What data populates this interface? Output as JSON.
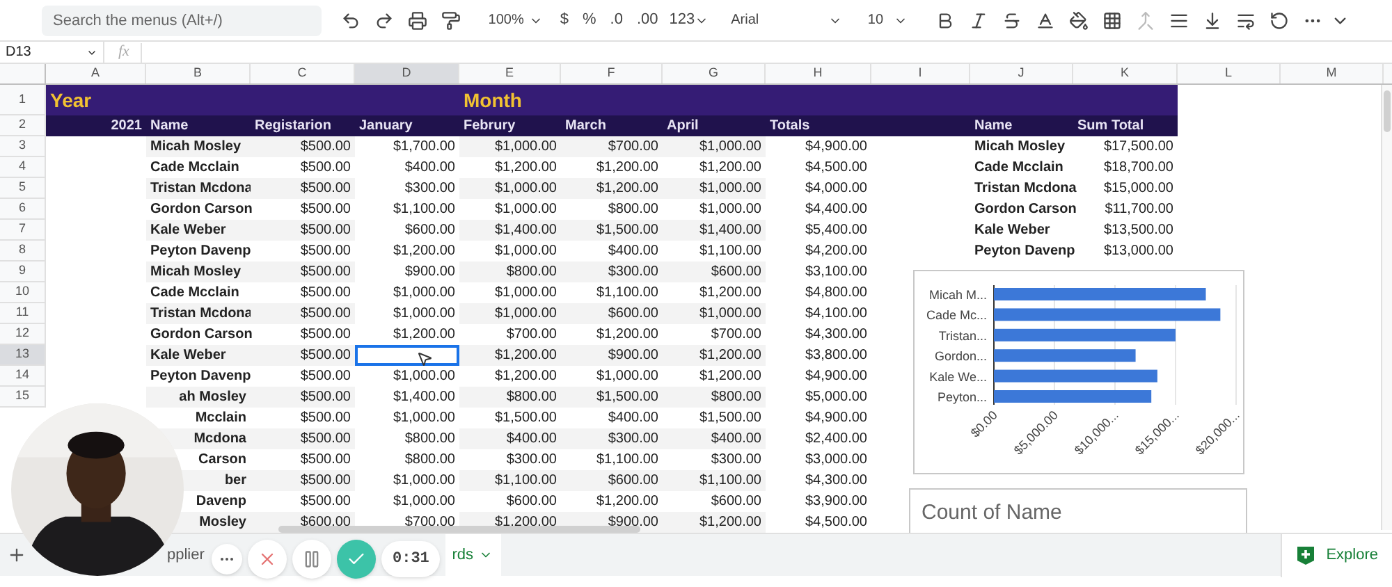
{
  "toolbar": {
    "search": {
      "placeholder": "Search the menus (Alt+/)"
    },
    "zoom": "100%",
    "currency": "$",
    "percent": "%",
    "decrease_decimals": ".0",
    "increase_decimals": ".00",
    "number_format": "123",
    "font": "Arial",
    "font_size": "10"
  },
  "formula_bar": {
    "cell_ref": "D13",
    "fx": "fx"
  },
  "columns": [
    {
      "label": "A",
      "selected": false
    },
    {
      "label": "B",
      "selected": false
    },
    {
      "label": "C",
      "selected": false
    },
    {
      "label": "D",
      "selected": true
    },
    {
      "label": "E",
      "selected": false
    },
    {
      "label": "F",
      "selected": false
    },
    {
      "label": "G",
      "selected": false
    },
    {
      "label": "H",
      "selected": false
    },
    {
      "label": "I",
      "selected": false
    },
    {
      "label": "J",
      "selected": false
    },
    {
      "label": "K",
      "selected": false
    },
    {
      "label": "L",
      "selected": false
    },
    {
      "label": "M",
      "selected": false
    }
  ],
  "header_rows": [
    {
      "number": "1",
      "selected": false,
      "cells": [
        "Year",
        null,
        null,
        null,
        "Month"
      ]
    },
    {
      "number": "2",
      "selected": false,
      "cells": [
        "2021",
        "Name",
        "Registarion",
        "January",
        "Februry",
        "March",
        "April",
        "Totals",
        null,
        "Name",
        "Sum Total"
      ]
    }
  ],
  "rows": [
    {
      "number": "3",
      "selected": false,
      "cells": [
        null,
        "Micah Mosley",
        "$500.00",
        "$1,700.00",
        "$1,000.00",
        "$700.00",
        "$1,000.00",
        "$4,900.00",
        null,
        "Micah Mosley",
        "$17,500.00"
      ]
    },
    {
      "number": "4",
      "selected": false,
      "cells": [
        null,
        "Cade Mcclain",
        "$500.00",
        "$400.00",
        "$1,200.00",
        "$1,200.00",
        "$1,200.00",
        "$4,500.00",
        null,
        "Cade Mcclain",
        "$18,700.00"
      ]
    },
    {
      "number": "5",
      "selected": false,
      "cells": [
        null,
        "Tristan Mcdona",
        "$500.00",
        "$300.00",
        "$1,000.00",
        "$1,200.00",
        "$1,000.00",
        "$4,000.00",
        null,
        "Tristan Mcdona",
        "$15,000.00"
      ]
    },
    {
      "number": "6",
      "selected": false,
      "cells": [
        null,
        "Gordon Carson",
        "$500.00",
        "$1,100.00",
        "$1,000.00",
        "$800.00",
        "$1,000.00",
        "$4,400.00",
        null,
        "Gordon Carson",
        "$11,700.00"
      ]
    },
    {
      "number": "7",
      "selected": false,
      "cells": [
        null,
        "Kale Weber",
        "$500.00",
        "$600.00",
        "$1,400.00",
        "$1,500.00",
        "$1,400.00",
        "$5,400.00",
        null,
        "Kale Weber",
        "$13,500.00"
      ]
    },
    {
      "number": "8",
      "selected": false,
      "cells": [
        null,
        "Peyton Davenp",
        "$500.00",
        "$1,200.00",
        "$1,000.00",
        "$400.00",
        "$1,100.00",
        "$4,200.00",
        null,
        "Peyton Davenp",
        "$13,000.00"
      ]
    },
    {
      "number": "9",
      "selected": false,
      "cells": [
        null,
        "Micah Mosley",
        "$500.00",
        "$900.00",
        "$800.00",
        "$300.00",
        "$600.00",
        "$3,100.00"
      ]
    },
    {
      "number": "10",
      "selected": false,
      "cells": [
        null,
        "Cade Mcclain",
        "$500.00",
        "$1,000.00",
        "$1,000.00",
        "$1,100.00",
        "$1,200.00",
        "$4,800.00"
      ]
    },
    {
      "number": "11",
      "selected": false,
      "cells": [
        null,
        "Tristan Mcdona",
        "$500.00",
        "$1,000.00",
        "$1,000.00",
        "$600.00",
        "$1,000.00",
        "$4,100.00"
      ]
    },
    {
      "number": "12",
      "selected": false,
      "cells": [
        null,
        "Gordon Carson",
        "$500.00",
        "$1,200.00",
        "$700.00",
        "$1,200.00",
        "$700.00",
        "$4,300.00"
      ]
    },
    {
      "number": "13",
      "selected": true,
      "cells": [
        null,
        "Kale Weber",
        "$500.00",
        null,
        "$1,200.00",
        "$900.00",
        "$1,200.00",
        "$3,800.00"
      ]
    },
    {
      "number": "14",
      "selected": false,
      "cells": [
        null,
        "Peyton Davenp",
        "$500.00",
        "$1,000.00",
        "$1,200.00",
        "$1,000.00",
        "$1,200.00",
        "$4,900.00"
      ]
    },
    {
      "number": "15",
      "selected": false,
      "cells": [
        null,
        "ah Mosley",
        "$500.00",
        "$1,400.00",
        "$800.00",
        "$1,500.00",
        "$800.00",
        "$5,000.00"
      ]
    },
    {
      "cells": [
        null,
        "Mcclain",
        "$500.00",
        "$1,000.00",
        "$1,500.00",
        "$400.00",
        "$1,500.00",
        "$4,900.00"
      ]
    },
    {
      "cells": [
        null,
        "Mcdona",
        "$500.00",
        "$800.00",
        "$400.00",
        "$300.00",
        "$400.00",
        "$2,400.00"
      ]
    },
    {
      "cells": [
        null,
        "Carson",
        "$500.00",
        "$800.00",
        "$300.00",
        "$1,100.00",
        "$300.00",
        "$3,000.00"
      ]
    },
    {
      "cells": [
        null,
        "ber",
        "$500.00",
        "$1,000.00",
        "$1,100.00",
        "$600.00",
        "$1,100.00",
        "$4,300.00"
      ]
    },
    {
      "cells": [
        null,
        "Davenp",
        "$500.00",
        "$1,000.00",
        "$600.00",
        "$1,200.00",
        "$600.00",
        "$3,900.00"
      ]
    },
    {
      "cells": [
        null,
        "Mosley",
        "$600.00",
        "$700.00",
        "$1,200.00",
        "$900.00",
        "$1,200.00",
        "$4,500.00"
      ]
    }
  ],
  "chart": {
    "chart_data": {
      "type": "bar",
      "orientation": "horizontal",
      "categories": [
        "Micah M...",
        "Cade Mc...",
        "Tristan...",
        "Gordon...",
        "Kale We...",
        "Peyton..."
      ],
      "series": [
        {
          "color": "#3c78d8",
          "values": [
            17500,
            18700,
            15000,
            11700,
            13500,
            13000
          ]
        }
      ],
      "grid": true,
      "xlim": [
        0,
        20000
      ],
      "xticks": [
        {
          "value": 0,
          "label": "$0.00"
        },
        {
          "value": 5000,
          "label": "$5,000.00"
        },
        {
          "value": 10000,
          "label": "$10,000..."
        },
        {
          "value": 15000,
          "label": "$15,000..."
        },
        {
          "value": 20000,
          "label": "$20,000..."
        }
      ]
    }
  },
  "second_chart": {
    "title": "Count of Name"
  },
  "recorder": {
    "timer": "0:31"
  },
  "sheet_tabs": [
    {
      "label": "pplier",
      "selected": false
    },
    {
      "label": "rds",
      "selected": true
    }
  ],
  "explore": {
    "label": "Explore"
  }
}
